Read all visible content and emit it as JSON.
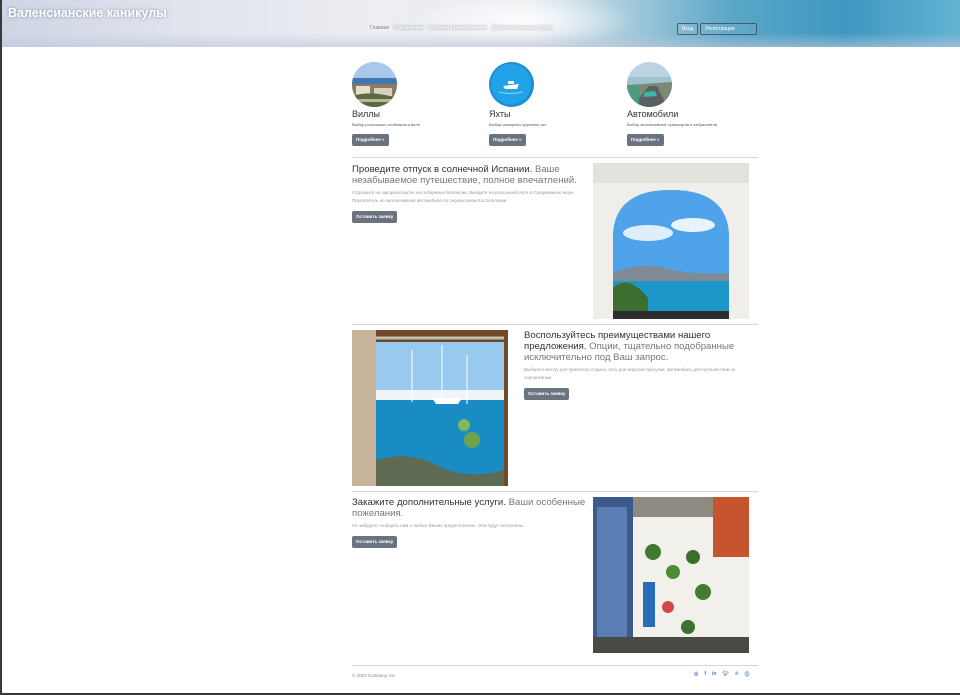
{
  "header": {
    "brand": "Валенсианские каникулы",
    "nav": [
      "Главная",
      "О компании",
      "Условия бронирования",
      "Дополнительные услуги"
    ],
    "auth": [
      "Вход",
      "Регистрация"
    ]
  },
  "features": [
    {
      "title": "Виллы",
      "text": "Выбор роскошных особняков и вилл",
      "button": "Подробнее »"
    },
    {
      "title": "Яхты",
      "text": "Выбор шикарных круизных яхт",
      "button": "Подробнее »"
    },
    {
      "title": "Автомобили",
      "text": "Выбор эксклюзивных суперкаров и кабриолетов",
      "button": "Подробнее »"
    }
  ],
  "promos": [
    {
      "heading": "Проведите отпуск в солнечной Испании.",
      "subheading": "Ваше незабываемое путешествие, полное впечатлений.",
      "text": "Отдохните на закорной вилле на побережье Валенсии. Выйдите на роскошной яхте в Средиземное море. Прокатитесь на эксклюзивном автомобиле по серпантинам Коста-Бланки",
      "button": "Оставить заявку"
    },
    {
      "heading": "Воспользуйтесь преимуществами нашего предложения.",
      "subheading": "Опции, тщательно подобранные исключительно под Ваш запрос.",
      "text": "Выберите виллу для приятного отдыха, яхту для морской прогулки, автомобиль для путешествий по серпантинам",
      "button": "Оставить заявку"
    },
    {
      "heading": "Закажите дополнительные услуги.",
      "subheading": "Ваши особенные пожелания.",
      "text": "Не забудьте сообщить нам о любых Ваших предпочтениях. Они будут исполнены.",
      "button": "Оставить заявку"
    }
  ],
  "footer": {
    "copyright": "© 2023 Company, Inc",
    "social": [
      "instagram-icon",
      "facebook-icon",
      "linkedin-icon",
      "twitter-icon",
      "pinterest-icon",
      "skype-icon"
    ]
  }
}
